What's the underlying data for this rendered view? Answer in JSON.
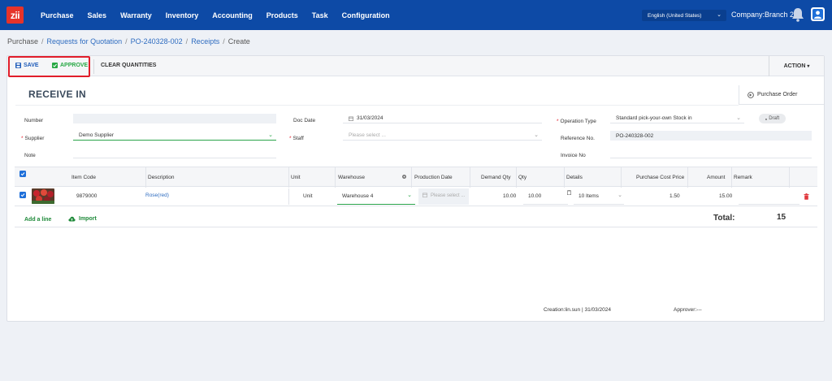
{
  "app": {
    "logo_text": "zii"
  },
  "nav": {
    "items": [
      "Purchase",
      "Sales",
      "Warranty",
      "Inventory",
      "Accounting",
      "Products",
      "Task",
      "Configuration"
    ],
    "language": "English (United States)",
    "company": "Company:Branch 2"
  },
  "breadcrumb": {
    "items": [
      "Purchase",
      "Requests for Quotation",
      "PO-240328-002",
      "Receipts",
      "Create"
    ]
  },
  "toolbar": {
    "save_label": "SAVE",
    "approve_label": "APPROVE",
    "clear_label": "CLEAR QUANTITIES",
    "action_label": "ACTION"
  },
  "form": {
    "title": "RECEIVE IN",
    "purchase_order_label": "Purchase Order",
    "status": "Draft",
    "number_label": "Number",
    "number_value": "",
    "supplier_label": "Supplier",
    "supplier_value": "Demo Supplier",
    "note_label": "Note",
    "doc_date_label": "Doc Date",
    "doc_date_value": "31/03/2024",
    "staff_label": "Staff",
    "staff_placeholder": "Please select ...",
    "operation_type_label": "Operation Type",
    "operation_type_value": "Standard pick-your-own Stock in",
    "reference_label": "Reference No.",
    "reference_value": "PO-240328-002",
    "invoice_label": "Invoice No"
  },
  "table": {
    "headers": {
      "item_code": "Item Code",
      "description": "Description",
      "unit": "Unit",
      "warehouse": "Warehouse",
      "production_date": "Production Date",
      "demand_qty": "Demand Qty",
      "qty": "Qty",
      "details": "Details",
      "purchase_cost_price": "Purchase Cost Price",
      "amount": "Amount",
      "remark": "Remark"
    },
    "rows": [
      {
        "item_code": "9879000",
        "description": "Rose(red)",
        "unit": "Unit",
        "warehouse": "Warehouse 4",
        "production_date_placeholder": "Please select ...",
        "demand_qty": "10.00",
        "qty": "10.00",
        "details": "10 Items",
        "purchase_cost_price": "1.50",
        "amount": "15.00",
        "remark": ""
      }
    ]
  },
  "footer": {
    "add_line": "Add a line",
    "import": "Import",
    "total_label": "Total:",
    "total_value": "15",
    "creation": "Creation:lin.sun | 31/03/2024",
    "approver": "Approver:---"
  },
  "colors": {
    "nav_bg": "#0d4aa6",
    "save_blue": "#1e5bb8",
    "approve_green": "#27a844",
    "highlight_red": "#e11d2a",
    "link_blue": "#2e6cc0"
  }
}
